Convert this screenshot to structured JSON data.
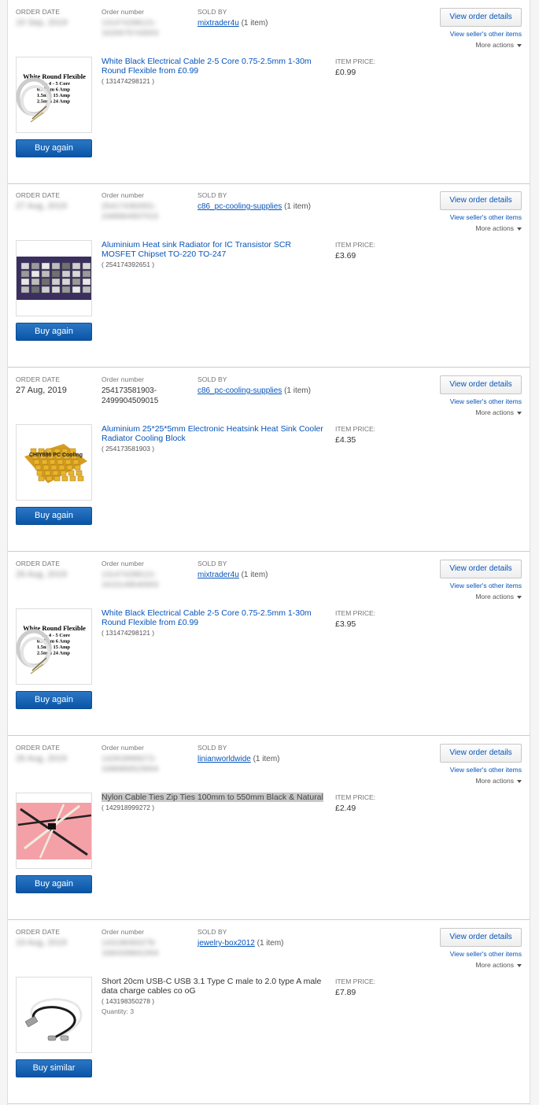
{
  "labels": {
    "order_date": "ORDER DATE",
    "order_number": "Order number",
    "sold_by": "SOLD BY",
    "item_price": "ITEM PRICE:",
    "view_order_details": "View order details",
    "view_sellers_other_items": "View seller's other items",
    "more_actions": "More actions"
  },
  "orders": [
    {
      "date": "15 Sep, 2019",
      "number_line1": "131474298121-",
      "number_line2": "1620675743003",
      "seller": "mixtrader4u",
      "item_count": "(1 item)",
      "title": "White Black Electrical Cable 2-5 Core 0.75-2.5mm 1-30m Round Flexible from £0.99",
      "item_id": "( 131474298121 )",
      "price": "£0.99",
      "button": "Buy again",
      "image": {
        "type": "cable",
        "heading": "White Round Flexible",
        "lines": [
          "3 - 4 - 5 Core",
          "0.75mm  6 Amp",
          "1.5mm  15 Amp",
          "2.5mm  24 Amp"
        ]
      }
    },
    {
      "date": "27 Aug, 2019",
      "number_line1": "254174392651-",
      "number_line2": "2499904507015",
      "seller": "c86_pc-cooling-supplies",
      "item_count": "(1 item)",
      "title": "Aluminium Heat sink Radiator for IC Transistor SCR MOSFET Chipset TO-220 TO-247",
      "item_id": "( 254174392651 )",
      "price": "£3.69",
      "button": "Buy again",
      "image": {
        "type": "heatsinks"
      }
    },
    {
      "date": "27 Aug, 2019",
      "number_line1": "254173581903-",
      "number_line2": "2499904509015",
      "seller": "c86_pc-cooling-supplies",
      "item_count": "(1 item)",
      "title": "Aluminium 25*25*5mm Electronic Heatsink Heat Sink Cooler Radiator Cooling Block",
      "item_id": "( 254173581903 )",
      "price": "£4.35",
      "button": "Buy again",
      "image": {
        "type": "gold",
        "caption": "CHIY886 PC Cooling"
      }
    },
    {
      "date": "26 Aug, 2019",
      "number_line1": "131474298121-",
      "number_line2": "1615149540003",
      "seller": "mixtrader4u",
      "item_count": "(1 item)",
      "title": "White Black Electrical Cable 2-5 Core 0.75-2.5mm 1-30m Round Flexible from £0.99",
      "item_id": "( 131474298121 )",
      "price": "£3.95",
      "button": "Buy again",
      "image": {
        "type": "cable",
        "heading": "White Round Flexible",
        "lines": [
          "3 - 4 - 5 Core",
          "0.75mm  6 Amp",
          "1.5mm  15 Amp",
          "2.5mm  24 Amp"
        ]
      }
    },
    {
      "date": "26 Aug, 2019",
      "number_line1": "142918999272-",
      "number_line2": "1686866523004",
      "seller": "linianworldwide",
      "item_count": "(1 item)",
      "title": "Nylon Cable Ties Zip Ties 100mm to 550mm Black & Natural",
      "item_id": "( 142918999272 )",
      "price": "£2.49",
      "button": "Buy again",
      "image": {
        "type": "ties"
      }
    },
    {
      "date": "19 Aug, 2019",
      "number_line1": "143198350278-",
      "number_line2": "1684339661004",
      "seller": "jewelry-box2012",
      "item_count": "(1 item)",
      "title": "Short 20cm USB-C USB 3.1 Type C male to 2.0 type A male data charge cables co oG",
      "item_id": "( 143198350278 )",
      "quantity": "Quantity: 3",
      "price": "£7.89",
      "button": "Buy similar",
      "image": {
        "type": "usb"
      }
    }
  ]
}
